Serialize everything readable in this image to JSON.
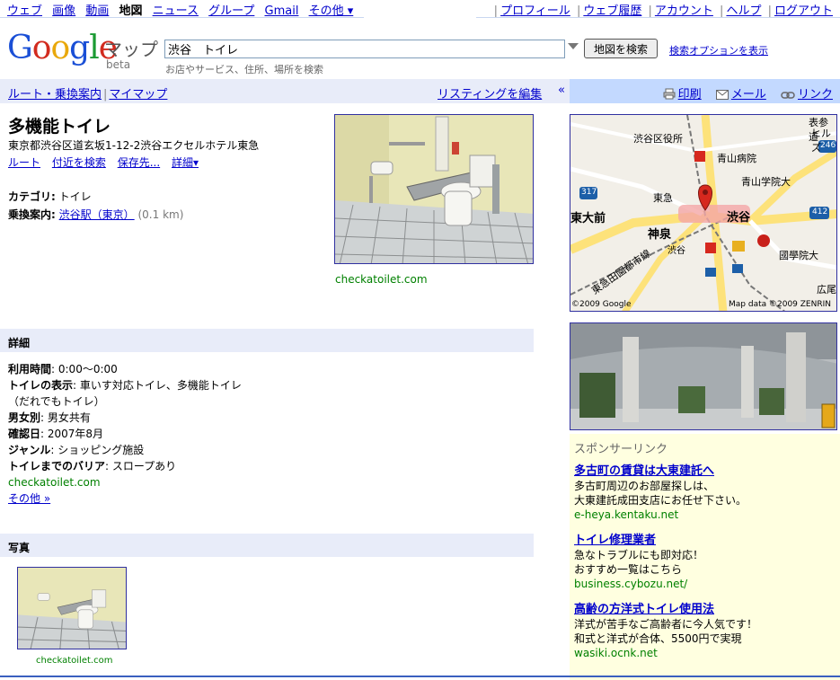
{
  "topbar": {
    "nav": [
      {
        "label": "ウェブ"
      },
      {
        "label": "画像"
      },
      {
        "label": "動画"
      },
      {
        "label": "地図",
        "current": true
      },
      {
        "label": "ニュース"
      },
      {
        "label": "グループ"
      },
      {
        "label": "Gmail"
      },
      {
        "label": "その他 ▾"
      }
    ],
    "account": [
      "プロフィール",
      "ウェブ履歴",
      "アカウント",
      "ヘルプ",
      "ログアウト"
    ]
  },
  "header": {
    "logo_letters": [
      "G",
      "o",
      "o",
      "g",
      "l",
      "e"
    ],
    "maps_word": "マップ",
    "beta": "beta",
    "search_value": "渋谷　トイレ",
    "search_button": "地図を検索",
    "search_options": "検索オプションを表示",
    "search_hint": "お店やサービス、住所、場所を検索"
  },
  "nav": {
    "route": "ルート・乗換案内",
    "mymaps": "マイマップ",
    "edit_listing": "リスティングを編集",
    "collapse": "«",
    "print": "印刷",
    "mail": "メール",
    "link": "リンク"
  },
  "place": {
    "title": "多機能トイレ",
    "address": "東京都渋谷区道玄坂1-12-2渋谷エクセルホテル東急",
    "actions": [
      "ルート",
      "付近を検索",
      "保存先..."
    ],
    "more": "詳細▾",
    "category_label": "カテゴリ:",
    "category_value": "トイレ",
    "transit_label": "乗換案内:",
    "transit_value": "渋谷駅（東京）",
    "transit_dist": "(0.1 km)",
    "photo_source": "checkatoilet.com"
  },
  "details": {
    "heading": "詳細",
    "rows": [
      {
        "label": "利用時間",
        "value": "0:00～0:00"
      },
      {
        "label": "トイレの表示",
        "value": "車いす対応トイレ、多機能トイレ（だれでもトイレ）"
      },
      {
        "label": "男女別",
        "value": "男女共有"
      },
      {
        "label": "確認日",
        "value": "2007年8月"
      },
      {
        "label": "ジャンル",
        "value": "ショッピング施設"
      },
      {
        "label": "トイレまでのバリア",
        "value": "スロープあり"
      }
    ],
    "source": "checkatoilet.com",
    "more_link": "その他 »"
  },
  "photos": {
    "heading": "写真",
    "thumb_source": "checkatoilet.com"
  },
  "map": {
    "labels": [
      "渋谷区役所",
      "青山病院",
      "青山学院大",
      "東急",
      "渋谷",
      "神泉",
      "東大前",
      "國學院大",
      "渋谷",
      "東急田園都市線",
      "広尾",
      "表参道",
      "ヒルズ"
    ],
    "shields": [
      "317",
      "246",
      "412"
    ],
    "copyright": "©2009 Google",
    "data_credit": "Map data ©2009 ZENRIN"
  },
  "sponsored": {
    "title": "スポンサーリンク",
    "ads": [
      {
        "title": "多古町の賃貸は大東建託へ",
        "line1": "多古町周辺のお部屋探しは、",
        "line2": "大東建託成田支店にお任せ下さい。",
        "url": "e-heya.kentaku.net"
      },
      {
        "title": "トイレ修理業者",
        "line1": "急なトラブルにも即対応！",
        "line2": "おすすめ一覧はこちら",
        "url": "business.cybozu.net/"
      },
      {
        "title": "高齢の方洋式トイレ使用法",
        "line1": "洋式が苦手なご高齢者に今人気です！",
        "line2": "和式と洋式が合体、5500円で実現",
        "url": "wasiki.ocnk.net"
      }
    ]
  },
  "colors": {
    "link": "#0000cc",
    "green_url": "#008000",
    "nav_left_bg": "#e8ecf9",
    "nav_right_bg": "#c3d9ff",
    "ads_bg": "#ffffe0"
  }
}
